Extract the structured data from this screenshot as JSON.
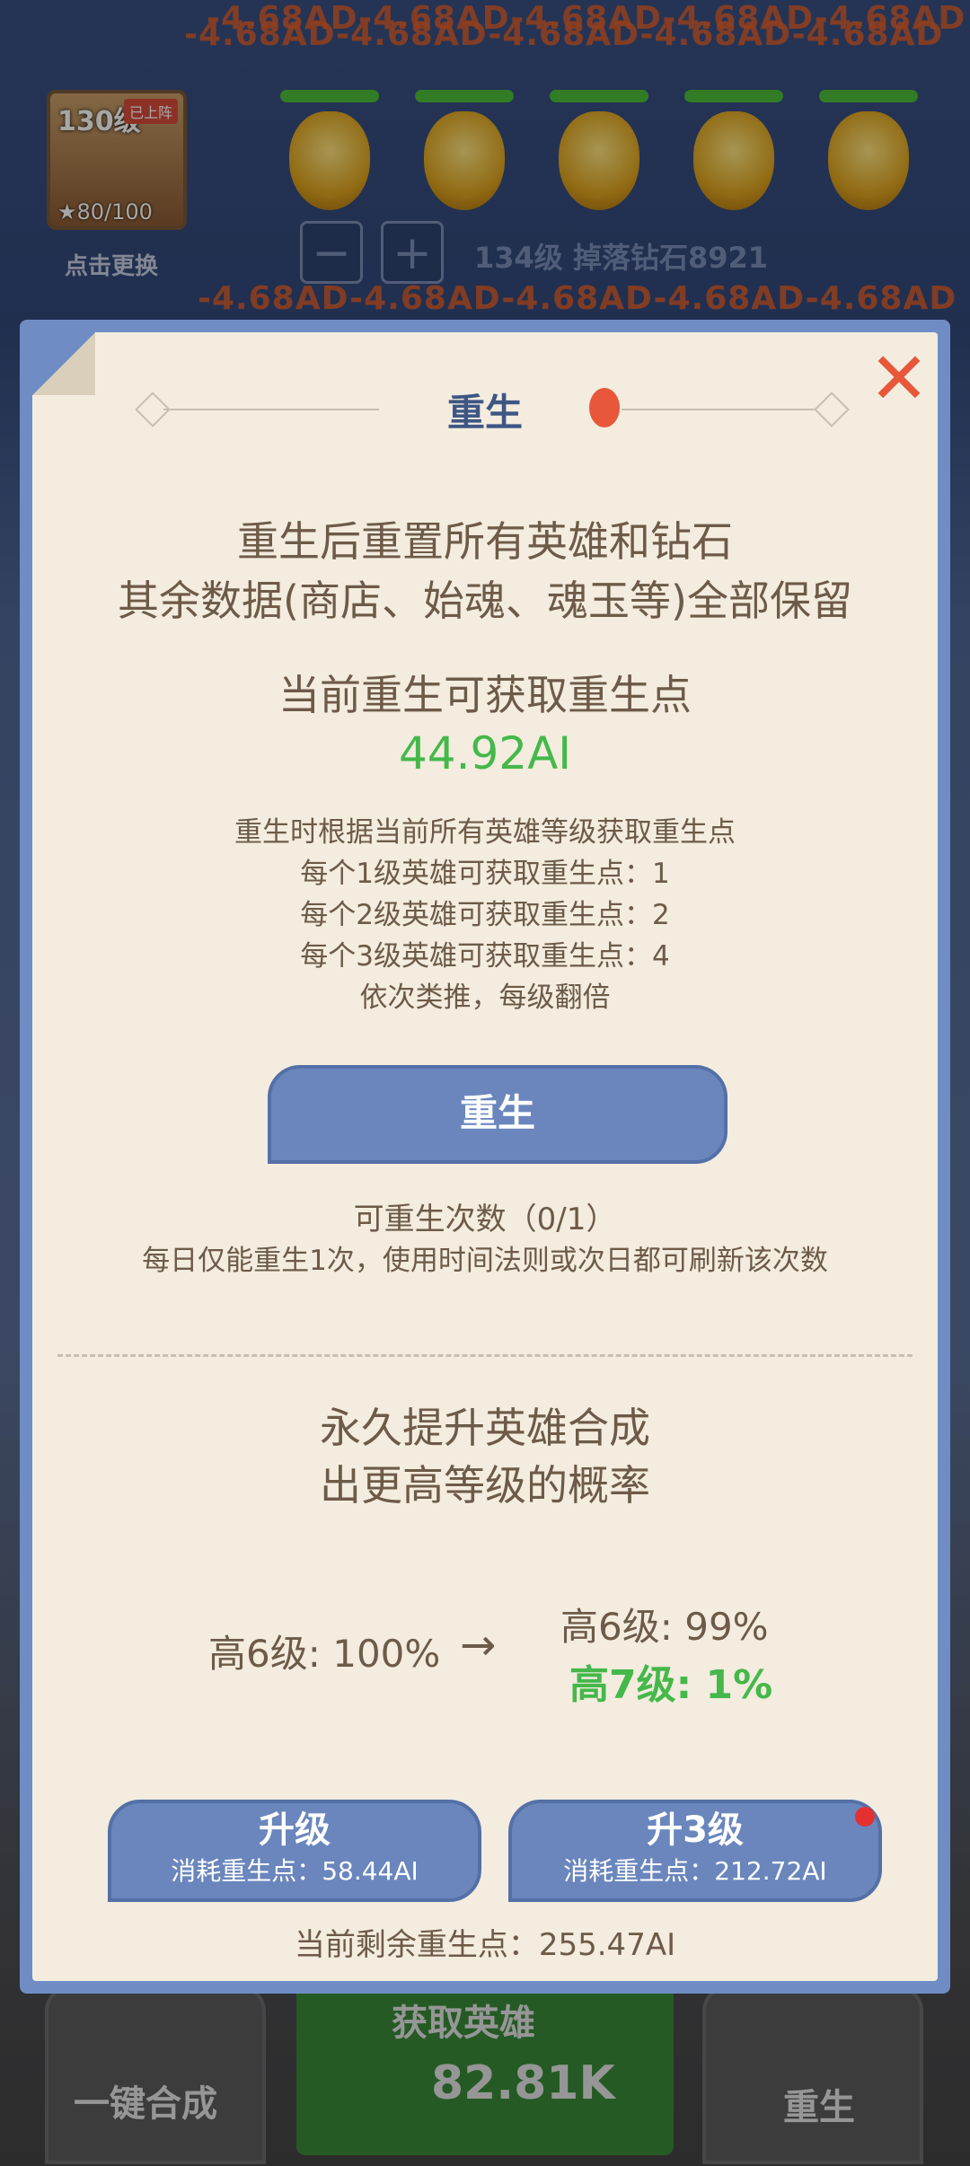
{
  "background": {
    "damage_texts": [
      "-4.68AD-4.68AD-4.68AD-4.68AD-4.68AD",
      "-4.68AD-4.68AD-4.68AD-4.68AD-4.68AD",
      "-4.68AD-4.68AD-4.68AD-4.68AD-4.68AD"
    ],
    "hero": {
      "level": "130级",
      "tag": "已上阵",
      "stars": "★80/100",
      "swap_label": "点击更换"
    },
    "minus": "−",
    "plus": "+",
    "drop_info": "134级 掉落钻石8921",
    "bottom": {
      "merge_label": "一键合成",
      "get_hero_label": "获取英雄",
      "gem_count": "82.81K",
      "rebirth_label": "重生"
    }
  },
  "dialog": {
    "title": "重生",
    "close_icon": "✕",
    "desc_line1": "重生后重置所有英雄和钻石",
    "desc_line2": "其余数据(商店、始魂、魂玉等)全部保留",
    "current_points_title": "当前重生可获取重生点",
    "current_points_value": "44.92AI",
    "rules": [
      "重生时根据当前所有英雄等级获取重生点",
      "每个1级英雄可获取重生点：1",
      "每个2级英雄可获取重生点：2",
      "每个3级英雄可获取重生点：4",
      "依次类推，每级翻倍"
    ],
    "rebirth_button": "重生",
    "rebirth_count": "可重生次数（0/1）",
    "rebirth_note": "每日仅能重生1次，使用时间法则或次日都可刷新该次数",
    "perm_line1": "永久提升英雄合成",
    "perm_line2": "出更高等级的概率",
    "prob_current": "高6级: 100%",
    "arrow": "→",
    "prob_next_1": "高6级: 99%",
    "prob_next_2": "高7级: 1%",
    "upgrade": {
      "label": "升级",
      "cost": "消耗重生点：58.44AI"
    },
    "upgrade3": {
      "label": "升3级",
      "cost": "消耗重生点：212.72AI"
    },
    "remaining": "当前剩余重生点：255.47AI"
  }
}
